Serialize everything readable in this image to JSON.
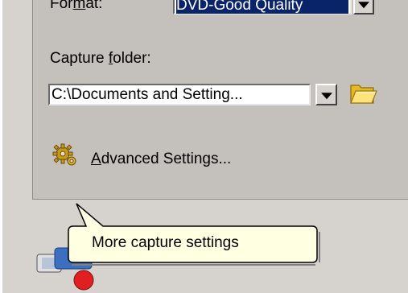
{
  "format": {
    "label_pre": "For",
    "label_access": "m",
    "label_post": "at:",
    "value": "DVD-Good Quality"
  },
  "capture_folder": {
    "label_pre": "Capture ",
    "label_access": "f",
    "label_post": "older:",
    "value": "C:\\Documents and Setting..."
  },
  "advanced": {
    "label_access": "A",
    "label_post": "dvanced Settings..."
  },
  "tooltip": {
    "text": "More capture settings"
  },
  "icons": {
    "folder": "folder-open-icon",
    "advanced": "gear-icon",
    "app": "capture-app-icon"
  },
  "colors": {
    "panel_bg": "#c4c1bc",
    "window_bg": "#d6d3ce",
    "selection": "#0a246a",
    "tooltip_bg": "#ffffe1"
  }
}
